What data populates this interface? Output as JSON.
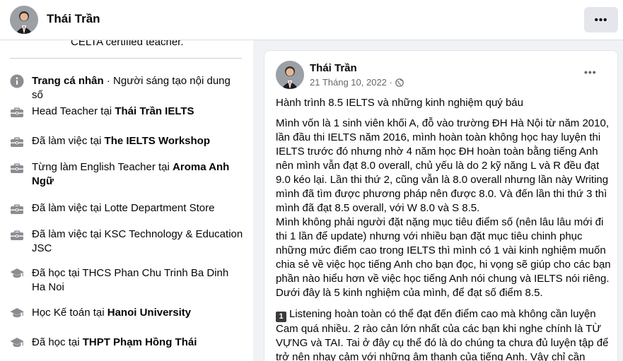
{
  "header": {
    "name": "Thái Trần",
    "more_label": "•••"
  },
  "intro": {
    "cut_off_text": "CELTA certified teacher.",
    "items": [
      {
        "icon": "info-icon",
        "prefix": "",
        "bold": "Trang cá nhân",
        "suffix": " · Người sáng tạo nội dung số"
      },
      {
        "icon": "briefcase-icon",
        "prefix": "Head Teacher tại ",
        "bold": "Thái Trần IELTS",
        "suffix": ""
      },
      {
        "icon": "briefcase-icon",
        "prefix": "Đã làm việc tại ",
        "bold": "The IELTS Workshop",
        "suffix": ""
      },
      {
        "icon": "briefcase-icon",
        "prefix": "Từng làm English Teacher tại ",
        "bold": "Aroma Anh Ngữ",
        "suffix": ""
      },
      {
        "icon": "briefcase-icon",
        "prefix": "Đã làm việc tại Lotte Department Store",
        "bold": "",
        "suffix": ""
      },
      {
        "icon": "briefcase-icon",
        "prefix": "Đã làm việc tại KSC Technology & Education JSC",
        "bold": "",
        "suffix": ""
      },
      {
        "icon": "graduation-cap-icon",
        "prefix": "Đã học tại THCS Phan Chu Trinh Ba Dinh Ha Noi",
        "bold": "",
        "suffix": ""
      },
      {
        "icon": "graduation-cap-icon",
        "prefix": "Học Kế toán tại ",
        "bold": "Hanoi University",
        "suffix": ""
      },
      {
        "icon": "graduation-cap-icon",
        "prefix": "Đã học tại ",
        "bold": "THPT Phạm Hồng Thái",
        "suffix": ""
      }
    ]
  },
  "post": {
    "author": "Thái Trần",
    "date": "21 Tháng 10, 2022",
    "privacy_icon": "globe-icon",
    "more_label": "•••",
    "title": "Hành trình 8.5 IELTS và những kinh nghiệm quý báu",
    "paragraph1": "Mình vốn là 1 sinh viên khối A, đỗ vào trường ĐH Hà Nội từ năm 2010, lần đầu thi IELTS năm 2016, mình hoàn toàn không học hay luyện thi IELTS trước đó nhưng nhờ 4 năm học ĐH hoàn toàn bằng tiếng Anh nên mình vẫn đạt 8.0 overall, chủ yếu là do 2 kỹ năng L và R đều đạt 9.0 kéo lại. Lần thi thứ 2, cũng vẫn là 8.0 overall nhưng lần này Writing mình đã tìm được phương pháp nên được 8.0. Và đến lần thi thứ 3 thì mình đã đạt 8.5 overall, với W 8.0 và S 8.5.",
    "paragraph2": "Mình không phải người đặt nặng mục tiêu điểm số (nên lâu lâu mới đi thi 1 lần để update) nhưng với nhiều bạn đặt mục tiêu chinh phục những mức điểm cao trong IELTS thì mình có 1 vài kinh nghiệm muốn chia sẻ về việc học tiếng Anh cho bạn đọc, hi vọng sẽ giúp cho các bạn phần nào hiểu hơn về việc học tiếng Anh nói chung và IELTS nói riêng. Dưới đây là 5 kinh nghiệm của mình, để đạt số điểm 8.5.",
    "tip_number": "1",
    "paragraph3": "Listening hoàn toàn có thể đạt đến điểm cao mà không cần luyện Cam quá nhiều. 2 rào cản lớn nhất của các bạn khi nghe chính là TỪ VỰNG và TAI. Tai ở đây cụ thể đó là do chúng ta chưa đủ luyện tập để trở nên nhạy cảm với những âm thanh của tiếng Anh. Vậy chỉ cần"
  }
}
